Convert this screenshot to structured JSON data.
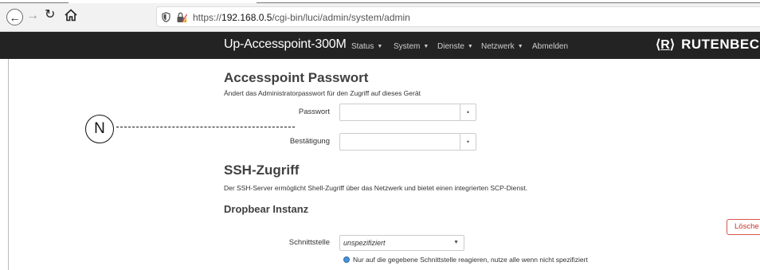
{
  "browser": {
    "url_host": "192.168.0.5",
    "url_prefix": "https://",
    "url_path": "/cgi-bin/luci/admin/system/admin",
    "back_icon": "arrow-left-icon",
    "forward_icon": "arrow-right-icon",
    "reload_icon": "reload-icon",
    "home_icon": "home-icon"
  },
  "header": {
    "brand": "Up-Accesspoint-300M",
    "menu": [
      {
        "label": "Status",
        "has_dropdown": true
      },
      {
        "label": "System",
        "has_dropdown": true
      },
      {
        "label": "Dienste",
        "has_dropdown": true
      },
      {
        "label": "Netzwerk",
        "has_dropdown": true
      },
      {
        "label": "Abmelden",
        "has_dropdown": false
      }
    ],
    "logo_mark": "R",
    "logo_text": "RUTENBEC"
  },
  "password_section": {
    "title": "Accesspoint Passwort",
    "description": "Ändert das Administratorpasswort für den Zugriff auf dieses Gerät",
    "password_label": "Passwort",
    "password_value": "",
    "confirm_label": "Bestätigung",
    "confirm_value": "",
    "reveal_glyph": "•"
  },
  "ssh_section": {
    "title": "SSH-Zugriff",
    "description": "Der SSH-Server ermöglicht Shell-Zugriff über das Netzwerk und bietet einen integrierten SCP-Dienst.",
    "subtitle": "Dropbear Instanz",
    "delete_label": "Lösche",
    "interface_label": "Schnittstelle",
    "interface_value": "unspezifiziert",
    "interface_hint": "Nur auf die gegebene Schnittstelle reagieren, nutze alle wenn nicht spezifiziert"
  },
  "annotation": {
    "callout_letter": "N"
  },
  "colors": {
    "header_bg": "#232323",
    "delete_red": "#d9534f",
    "hint_blue": "#4a90d9"
  }
}
